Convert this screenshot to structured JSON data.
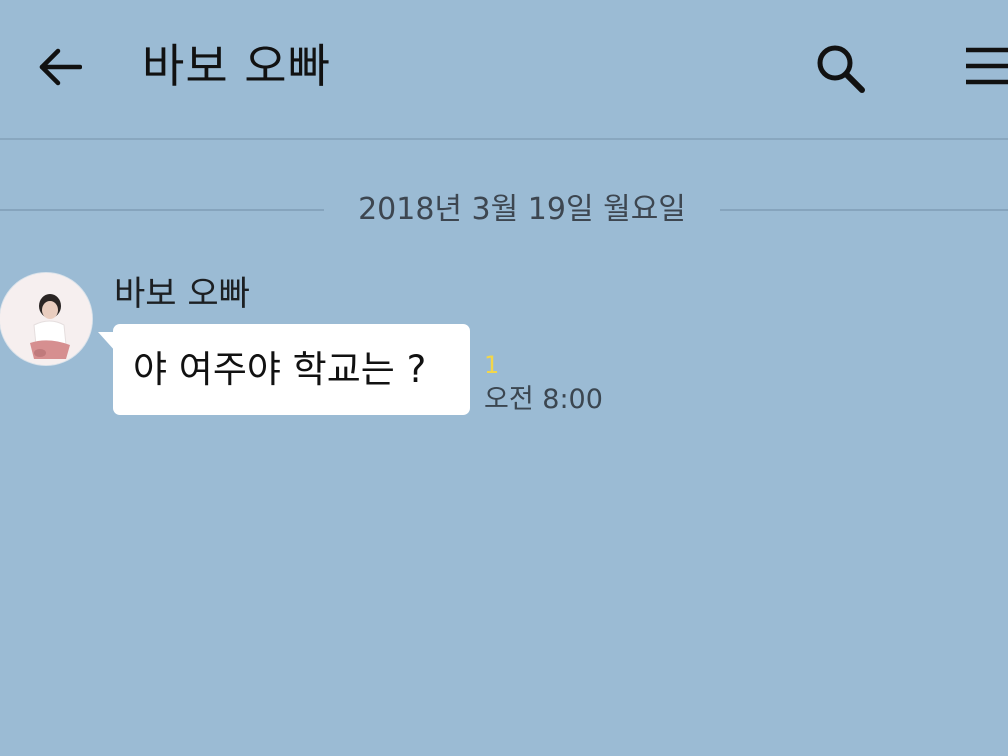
{
  "header": {
    "title": "바보 오빠",
    "back_icon": "arrow-left-icon",
    "search_icon": "search-icon",
    "menu_icon": "hamburger-menu-icon"
  },
  "chat": {
    "date_divider": "2018년 3월 19일 월요일",
    "messages": [
      {
        "sender": "바보 오빠",
        "text": "야 여주야 학교는 ?",
        "unread_count": "1",
        "time": "오전 8:00"
      }
    ]
  },
  "colors": {
    "background": "#9bbbd4",
    "bubble": "#ffffff",
    "unread": "#f2d64a",
    "divider": "#86a4bd"
  }
}
